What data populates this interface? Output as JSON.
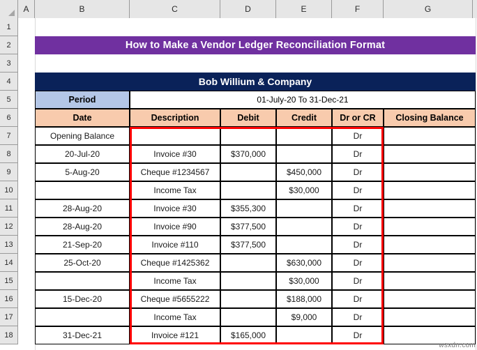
{
  "app": {
    "type": "spreadsheet",
    "watermark": "wsxdn.com"
  },
  "colors": {
    "title_purple": "#7030A0",
    "company_navy": "#0A2259",
    "period_blue": "#B4C7E7",
    "header_peach": "#F8CBAD",
    "highlight_red": "#FF0000",
    "gridline": "#D9D9D9",
    "header_gray": "#E6E6E6"
  },
  "column_headers": [
    "A",
    "B",
    "C",
    "D",
    "E",
    "F",
    "G"
  ],
  "row_headers": [
    "1",
    "2",
    "3",
    "4",
    "5",
    "6",
    "7",
    "8",
    "9",
    "10",
    "11",
    "12",
    "13",
    "14",
    "15",
    "16",
    "17",
    "18"
  ],
  "banners": {
    "title": "How to Make a Vendor Ledger Reconciliation Format",
    "company": "Bob Willium & Company"
  },
  "period": {
    "label": "Period",
    "value": "01-July-20 To 31-Dec-21"
  },
  "table": {
    "headers": [
      "Date",
      "Description",
      "Debit",
      "Credit",
      "Dr or CR",
      "Closing Balance"
    ],
    "rows": [
      {
        "date": "Opening Balance",
        "description": "",
        "debit": "",
        "credit": "",
        "drcr": "Dr",
        "closing": ""
      },
      {
        "date": "20-Jul-20",
        "description": "Invoice #30",
        "debit": "$370,000",
        "credit": "",
        "drcr": "Dr",
        "closing": ""
      },
      {
        "date": "5-Aug-20",
        "description": "Cheque #1234567",
        "debit": "",
        "credit": "$450,000",
        "drcr": "Dr",
        "closing": ""
      },
      {
        "date": "",
        "description": "Income Tax",
        "debit": "",
        "credit": "$30,000",
        "drcr": "Dr",
        "closing": ""
      },
      {
        "date": "28-Aug-20",
        "description": "Invoice #30",
        "debit": "$355,300",
        "credit": "",
        "drcr": "Dr",
        "closing": ""
      },
      {
        "date": "28-Aug-20",
        "description": "Invoice #90",
        "debit": "$377,500",
        "credit": "",
        "drcr": "Dr",
        "closing": ""
      },
      {
        "date": "21-Sep-20",
        "description": "Invoice #110",
        "debit": "$377,500",
        "credit": "",
        "drcr": "Dr",
        "closing": ""
      },
      {
        "date": "25-Oct-20",
        "description": "Cheque #1425362",
        "debit": "",
        "credit": "$630,000",
        "drcr": "Dr",
        "closing": ""
      },
      {
        "date": "",
        "description": "Income Tax",
        "debit": "",
        "credit": "$30,000",
        "drcr": "Dr",
        "closing": ""
      },
      {
        "date": "15-Dec-20",
        "description": "Cheque #5655222",
        "debit": "",
        "credit": "$188,000",
        "drcr": "Dr",
        "closing": ""
      },
      {
        "date": "",
        "description": "Income Tax",
        "debit": "",
        "credit": "$9,000",
        "drcr": "Dr",
        "closing": ""
      },
      {
        "date": "31-Dec-21",
        "description": "Invoice #121",
        "debit": "$165,000",
        "credit": "",
        "drcr": "Dr",
        "closing": ""
      }
    ]
  }
}
